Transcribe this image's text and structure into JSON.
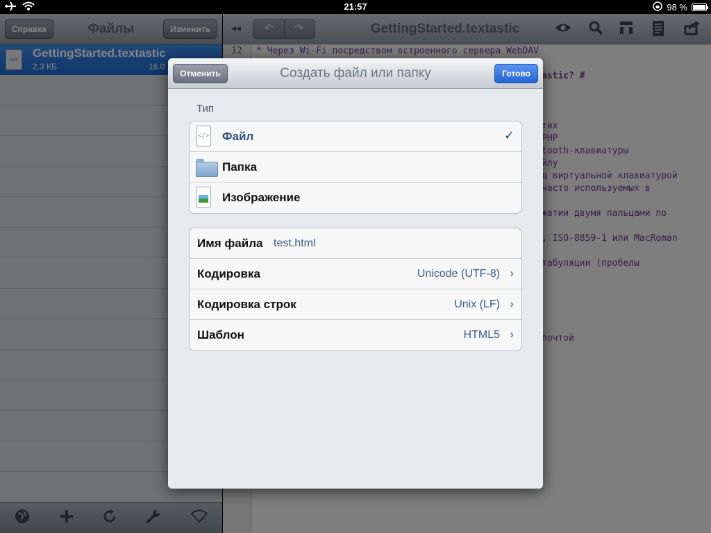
{
  "status_bar": {
    "time": "21:57",
    "battery": "98 %",
    "battery_fraction": 0.98
  },
  "left_pane": {
    "help_button": "Справка",
    "title": "Файлы",
    "edit_button": "Изменить",
    "file": {
      "name": "GettingStarted.textastic",
      "size": "2.3 КБ",
      "date": "16.0",
      "icon_text": "</>"
    },
    "bottom_icons": [
      "globe-icon",
      "plus-icon",
      "refresh-icon",
      "wrench-icon",
      "wifi-icon"
    ]
  },
  "editor": {
    "title": "GettingStarted.textastic",
    "undo": "↶",
    "redo": "↷",
    "back": "◂◂",
    "line_number": "12",
    "lines": [
      "* Через Wi-Fi посредством встроенного сервера WebDAV",
      "astic? #",
      "тих",
      "PHP",
      "tooth-клавиатуры",
      "йлу",
      "д виртуальной клавиатурой",
      "часто используемых в",
      "жатии двумя пальцами по",
      ", ISO-8859-1 или MacRoman",
      "табуляции (пробелы",
      "почтой"
    ]
  },
  "modal": {
    "title": "Создать файл или папку",
    "cancel_button": "Отменить",
    "done_button": "Готово",
    "type_section_label": "Тип",
    "types": [
      {
        "label": "Файл",
        "icon": "file-icon",
        "selected": true,
        "checkmark": "✓"
      },
      {
        "label": "Папка",
        "icon": "folder-icon",
        "selected": false
      },
      {
        "label": "Изображение",
        "icon": "image-icon",
        "selected": false
      }
    ],
    "filename_label": "Имя файла",
    "filename_value": "test.html",
    "options": [
      {
        "label": "Кодировка",
        "value": "Unicode (UTF-8)"
      },
      {
        "label": "Кодировка строк",
        "value": "Unix (LF)"
      },
      {
        "label": "Шаблон",
        "value": "HTML5"
      }
    ],
    "chevron": "›"
  },
  "colors": {
    "selection_blue": "#2a73da",
    "done_blue": "#2562d5",
    "value_blue": "#3e5a86"
  }
}
